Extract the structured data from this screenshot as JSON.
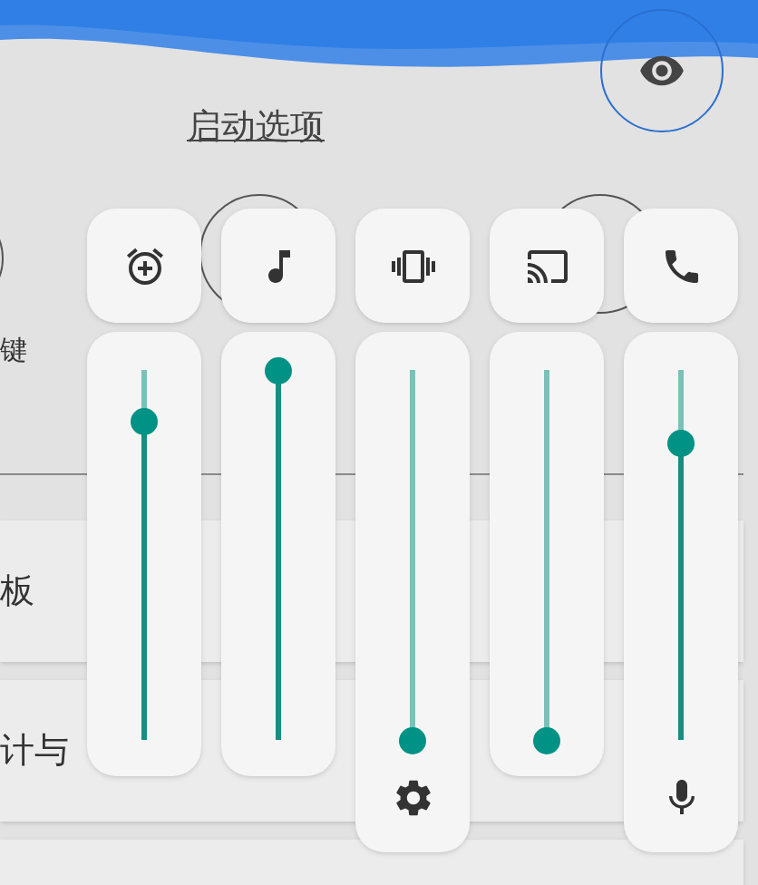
{
  "header": {
    "title": "启动选项"
  },
  "shortcut_labels": [
    {
      "label": "键"
    }
  ],
  "cards": [
    {
      "label": "板"
    },
    {
      "label": "计与"
    }
  ],
  "volume_panel": {
    "streams": [
      {
        "kind": "alarm",
        "level": 0.86
      },
      {
        "kind": "music",
        "level": 1
      },
      {
        "kind": "vibrate",
        "level": 0,
        "footer": {
          "kind": "settings"
        }
      },
      {
        "kind": "cast",
        "level": 0
      },
      {
        "kind": "phone",
        "level": 0.8,
        "footer": {
          "kind": "mic"
        }
      }
    ]
  }
}
